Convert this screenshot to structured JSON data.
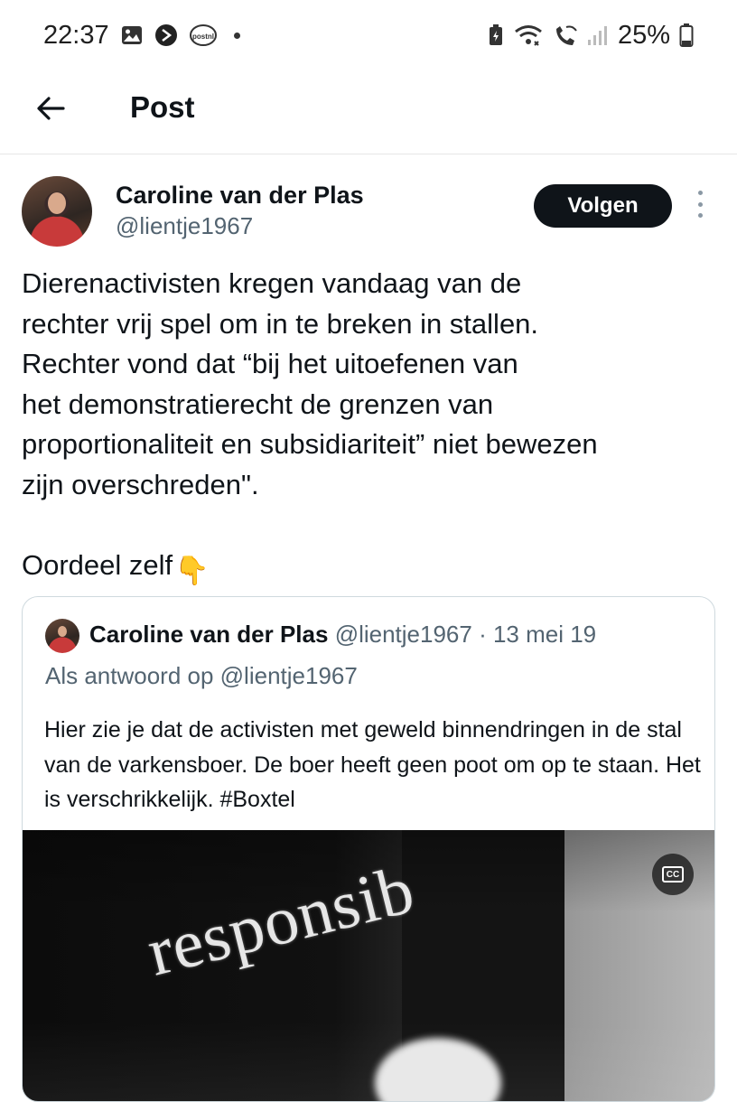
{
  "status_bar": {
    "time": "22:37",
    "left_icons": [
      "gallery-icon",
      "app-icon",
      "postnl-icon"
    ],
    "right_icons": [
      "battery-saver-icon",
      "wifi-icon",
      "wifi-call-icon",
      "signal-icon"
    ],
    "battery": "25%"
  },
  "header": {
    "title": "Post"
  },
  "post": {
    "author_name": "Caroline van der Plas",
    "author_handle": "@lientje1967",
    "follow_label": "Volgen",
    "text": "Dierenactivisten kregen vandaag van de\nrechter vrij spel om in te breken in stallen.\nRechter vond dat “bij het uitoefenen van\nhet demonstratierecht de grenzen van\nproportionaliteit en subsidiariteit” niet bewezen\nzijn overschreden\".",
    "text2": "Oordeel zelf",
    "text2_emoji": "👇"
  },
  "quote": {
    "author_name": "Caroline van der Plas",
    "meta": "@lientje1967 · 13 mei 19",
    "reply_to": "Als antwoord op @lientje1967",
    "text": "Hier zie je dat de activisten met geweld binnendringen in de stal van de varkensboer. De boer heeft geen poot om op te staan. Het is verschrikkelijk. #Boxtel",
    "media_caption": "responsib",
    "cc_label": "CC"
  }
}
